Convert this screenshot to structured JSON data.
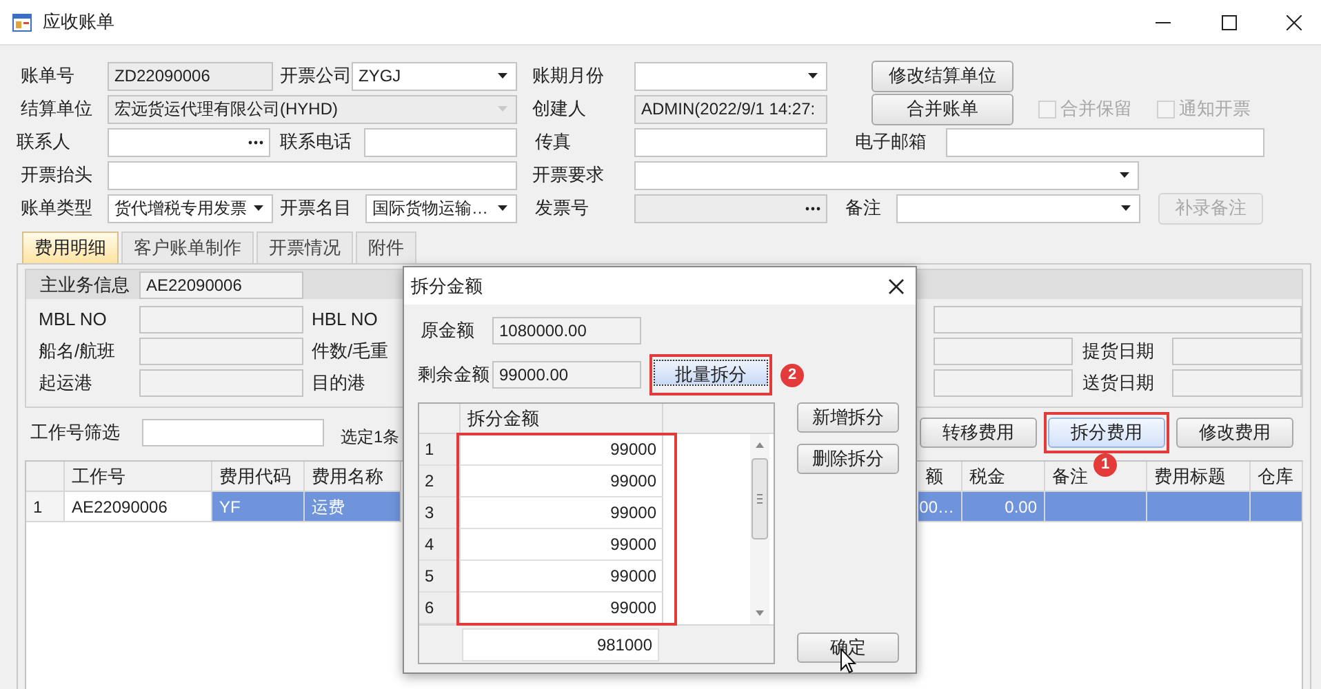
{
  "window": {
    "title": "应收账单"
  },
  "form": {
    "rows": [
      [
        {
          "kind": "label",
          "text": "账单号"
        },
        {
          "kind": "text",
          "value": "ZD22090006",
          "readonly": true
        },
        {
          "kind": "label",
          "text": "开票公司"
        },
        {
          "kind": "combo",
          "value": "ZYGJ",
          "disabled": false
        },
        {
          "kind": "label",
          "text": "账期月份"
        },
        {
          "kind": "combo",
          "disabled": false
        },
        {
          "kind": "button",
          "text": "修改结算单位",
          "disabled": false
        }
      ],
      [
        {
          "kind": "label",
          "text": "结算单位"
        },
        {
          "kind": "combo",
          "value": "宏远货运代理有限公司(HYHD)",
          "disabled": true
        },
        {
          "kind": "label",
          "text": "创建人"
        },
        {
          "kind": "text",
          "value": "ADMIN(2022/9/1 14:27:",
          "readonly": true
        },
        {
          "kind": "button",
          "text": "合并账单",
          "disabled": false
        }
      ],
      [
        {
          "kind": "label",
          "text": "联系人"
        },
        {
          "kind": "lookup",
          "readonly": false
        },
        {
          "kind": "label",
          "text": "联系电话"
        },
        {
          "kind": "text",
          "readonly": false
        },
        {
          "kind": "label",
          "text": "传真"
        },
        {
          "kind": "text",
          "readonly": false
        },
        {
          "kind": "label",
          "text": "电子邮箱"
        },
        {
          "kind": "text",
          "readonly": false
        }
      ],
      [
        {
          "kind": "label",
          "text": "开票抬头"
        },
        {
          "kind": "text",
          "readonly": false
        },
        {
          "kind": "label",
          "text": "开票要求"
        },
        {
          "kind": "combo",
          "disabled": false
        }
      ],
      [
        {
          "kind": "label",
          "text": "账单类型"
        },
        {
          "kind": "combo",
          "value": "货代增税专用发票",
          "disabled": false
        },
        {
          "kind": "label",
          "text": "开票名目"
        },
        {
          "kind": "combo",
          "value": "国际货物运输…",
          "disabled": false
        },
        {
          "kind": "label",
          "text": "发票号"
        },
        {
          "kind": "lookup",
          "readonly": true
        },
        {
          "kind": "label",
          "text": "备注"
        },
        {
          "kind": "combo",
          "disabled": false
        },
        {
          "kind": "button",
          "text": "补录备注",
          "disabled": true
        }
      ]
    ],
    "options": [
      {
        "text": "合并保留",
        "checked": false,
        "disabled": true
      },
      {
        "text": "通知开票",
        "checked": false,
        "disabled": true
      }
    ]
  },
  "tabs": [
    {
      "label": "费用明细",
      "selected": true
    },
    {
      "label": "客户账单制作",
      "selected": false
    },
    {
      "label": "开票情况",
      "selected": false
    },
    {
      "label": "附件",
      "selected": false
    }
  ],
  "info": {
    "header": {
      "label": "主业务信息",
      "value": "AE22090006"
    },
    "rows": [
      {
        "label": "MBL NO",
        "label_2": "HBL NO"
      },
      {
        "label": "船名/航班",
        "label_2": "件数/毛重",
        "date_label": "提货日期"
      },
      {
        "label": "起运港",
        "label_2": "目的港",
        "date_label": "送货日期"
      }
    ]
  },
  "filter": {
    "label": "工作号筛选",
    "selection": "选定1条"
  },
  "actions": [
    {
      "label": "转移费用",
      "highlighted": false
    },
    {
      "label": "拆分费用",
      "highlighted": true,
      "badge": "1"
    },
    {
      "label": "修改费用",
      "highlighted": false
    }
  ],
  "grid": {
    "columns": [
      {
        "kind": "data",
        "label": "工作号"
      },
      {
        "kind": "data",
        "label": "费用代码"
      },
      {
        "kind": "data",
        "label": "费用名称"
      },
      {
        "kind": "data",
        "label": "额"
      },
      {
        "kind": "data",
        "label": "税金"
      },
      {
        "kind": "data",
        "label": "备注"
      },
      {
        "kind": "data",
        "label": "费用标题"
      },
      {
        "kind": "data",
        "label": "仓库"
      }
    ],
    "rows": [
      {
        "number": "1",
        "selected": true,
        "cells": [
          {
            "text": "AE22090006",
            "current": true
          },
          {
            "text": "YF",
            "current": false
          },
          {
            "text": "运费",
            "current": false
          },
          {
            "text": "00…",
            "current": false
          },
          {
            "text": "0.00",
            "current": false
          },
          {
            "current": false
          },
          {
            "current": false
          },
          {
            "current": false
          }
        ]
      }
    ]
  },
  "dialog": {
    "title": "拆分金额",
    "original": {
      "label": "原金额",
      "value": "1080000.00"
    },
    "remaining": {
      "label": "剩余金额",
      "value": "99000.00"
    },
    "batch_button": {
      "label": "批量拆分",
      "highlighted": true,
      "badge": "2"
    },
    "grid": {
      "column": "拆分金额",
      "highlighted": true,
      "rows": [
        {
          "index": "1",
          "amount": "99000"
        },
        {
          "index": "2",
          "amount": "99000"
        },
        {
          "index": "3",
          "amount": "99000"
        },
        {
          "index": "4",
          "amount": "99000"
        },
        {
          "index": "5",
          "amount": "99000"
        },
        {
          "index": "6",
          "amount": "99000"
        }
      ],
      "total": "981000"
    },
    "buttons": [
      "新增拆分",
      "删除拆分"
    ],
    "ok_button": "确定"
  }
}
